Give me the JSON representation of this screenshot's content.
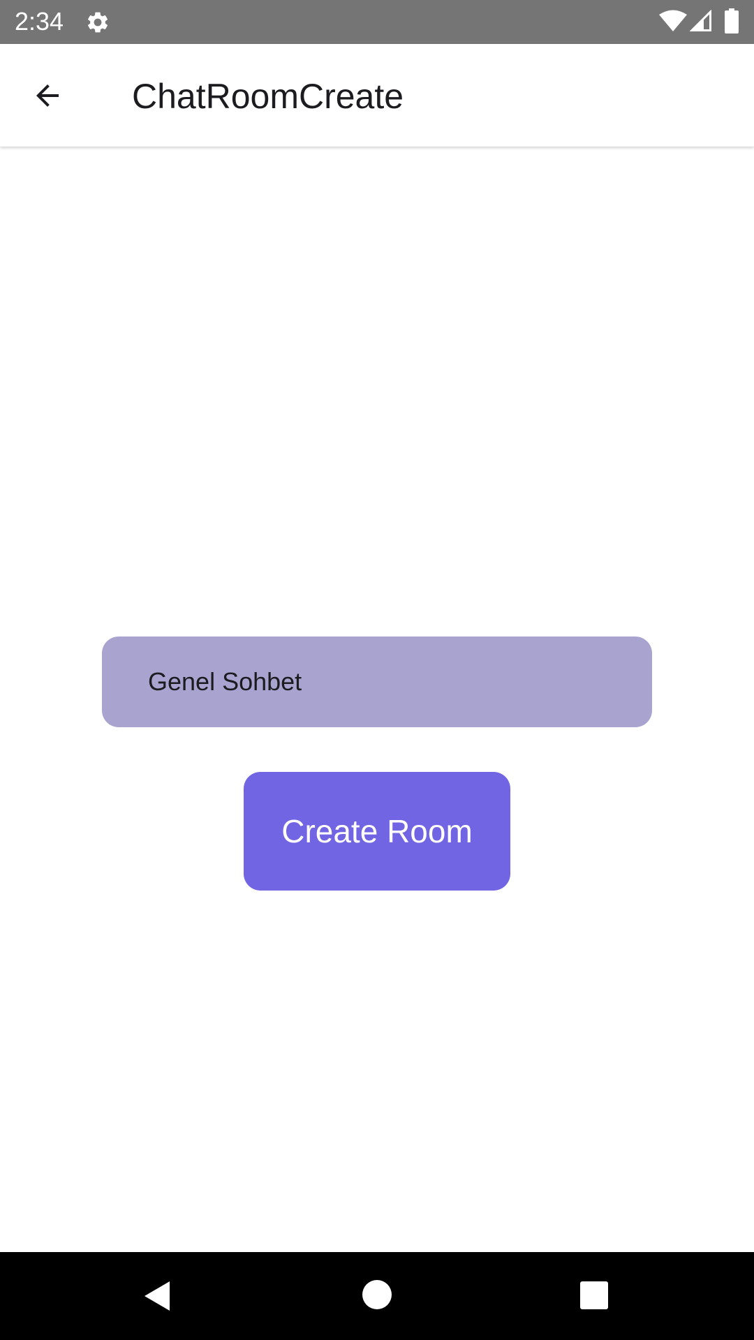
{
  "status_bar": {
    "time": "2:34",
    "icons": [
      "gear-icon",
      "wifi-icon",
      "cell-signal-icon",
      "battery-icon"
    ]
  },
  "app_bar": {
    "title": "ChatRoomCreate",
    "back_icon": "arrow-back-icon"
  },
  "form": {
    "room_name_value": "Genel Sohbet",
    "create_button_label": "Create Room"
  },
  "nav_bar": {
    "icons": [
      "nav-back-icon",
      "nav-home-icon",
      "nav-recents-icon"
    ]
  },
  "colors": {
    "status_bar_bg": "#757575",
    "field_bg": "#a9a3d0",
    "button_bg": "#7165e3",
    "nav_bar_bg": "#000000"
  }
}
